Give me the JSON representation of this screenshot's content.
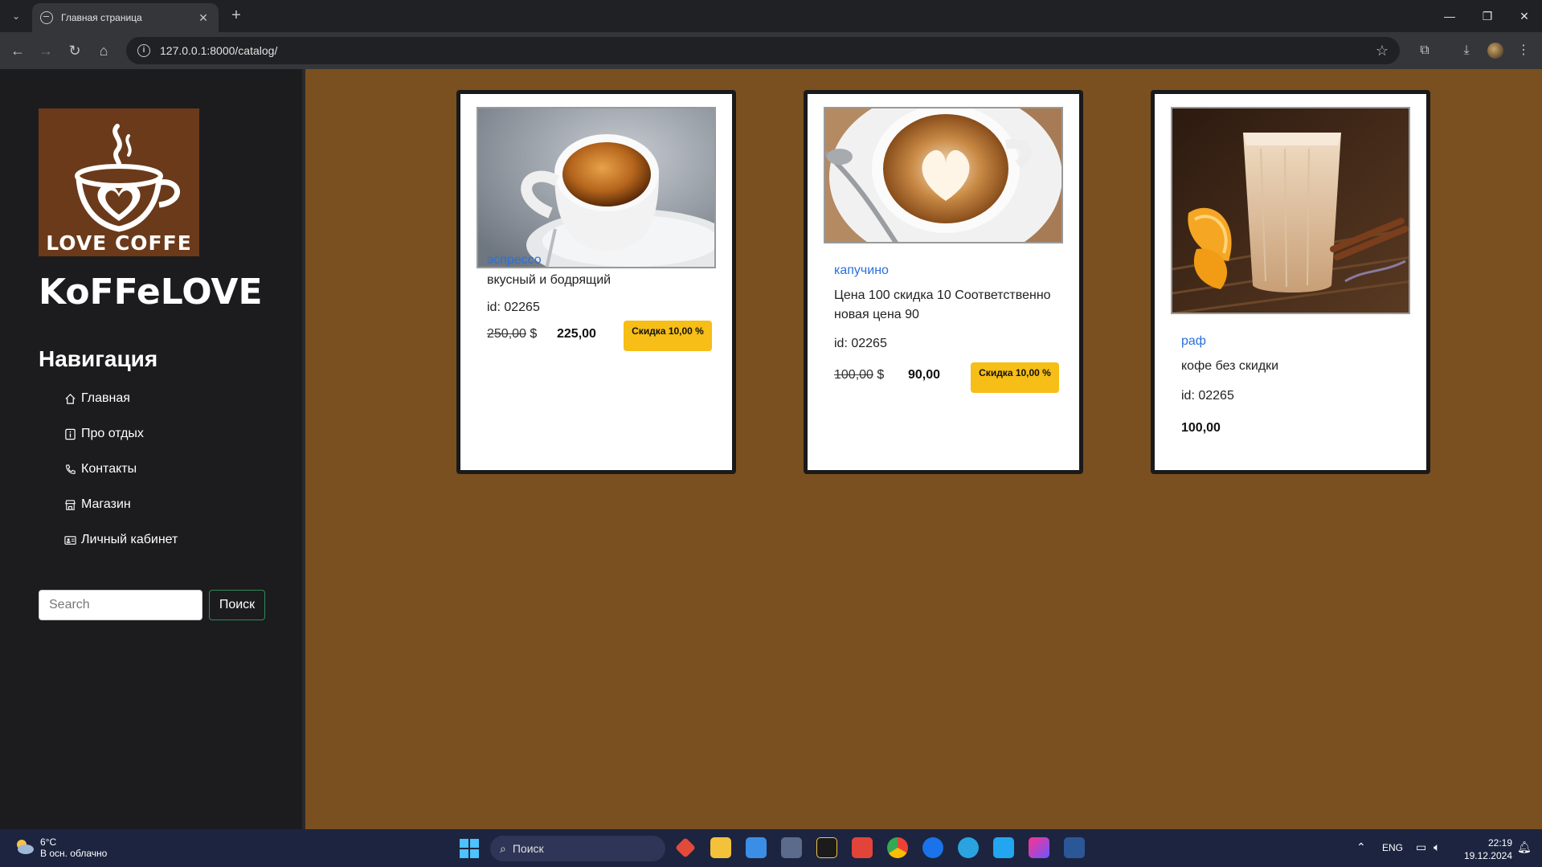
{
  "browser": {
    "tab_title": "Главная страница",
    "url": "127.0.0.1:8000/catalog/"
  },
  "sidebar": {
    "logo_text": "LOVE COFFE",
    "site_name": "KoFFeLOVE",
    "nav_heading": "Навигация",
    "nav_items": [
      {
        "label": "Главная",
        "icon": "home-icon"
      },
      {
        "label": "Про отдых",
        "icon": "info-icon"
      },
      {
        "label": "Контакты",
        "icon": "phone-icon"
      },
      {
        "label": "Магазин",
        "icon": "shop-icon"
      },
      {
        "label": "Личный кабинет",
        "icon": "id-card-icon"
      }
    ],
    "search_placeholder": "Search",
    "search_button": "Поиск"
  },
  "products": [
    {
      "name": "эспрессо",
      "description": "вкусный и бодрящий",
      "id_text": "id: 02265",
      "old_price": "250,00",
      "currency": "$",
      "new_price": "225,00",
      "badge": "Скидка 10,00 %"
    },
    {
      "name": "капучино",
      "description": "Цена 100 скидка 10 Соответственно новая цена 90",
      "id_text": "id: 02265",
      "old_price": "100,00",
      "currency": "$",
      "new_price": "90,00",
      "badge": "Скидка 10,00 %"
    },
    {
      "name": "раф",
      "description": "кофе без скидки",
      "id_text": "id: 02265",
      "price": "100,00"
    }
  ],
  "taskbar": {
    "temperature": "6°C",
    "weather": "В осн. облачно",
    "search_label": "Поиск",
    "language": "ENG",
    "time": "22:19",
    "date": "19.12.2024"
  },
  "colors": {
    "page_background": "#7a5020",
    "sidebar_background": "#1c1c1e",
    "badge": "#f6be16",
    "link": "#2a6fdb"
  }
}
